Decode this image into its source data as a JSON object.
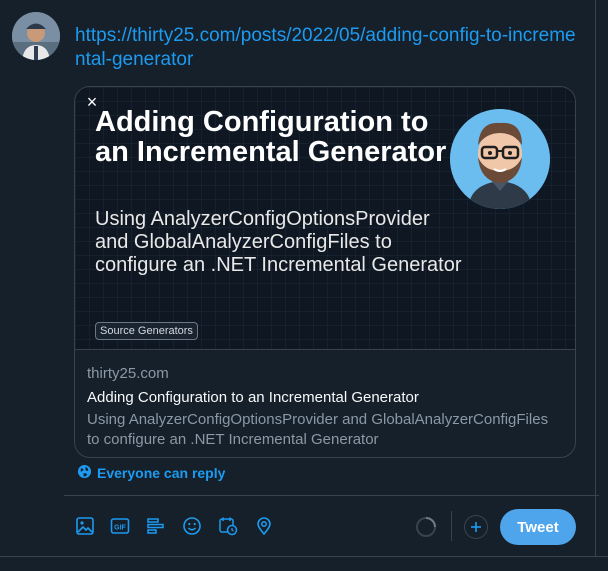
{
  "tweet": {
    "link_text": "https://thirty25.com/posts/2022/05/adding-config-to-incremental-generator"
  },
  "card": {
    "image": {
      "title": "Adding Configuration to an Incremental Generator",
      "subtitle": "Using AnalyzerConfigOptionsProvider and GlobalAnalyzerConfigFiles to configure an .NET Incremental Generator",
      "tag": "Source Generators",
      "close_symbol": "×"
    },
    "domain": "thirty25.com",
    "title": "Adding Configuration to an Incremental Generator",
    "description": "Using AnalyzerConfigOptionsProvider and GlobalAnalyzerConfigFiles to configure an .NET Incremental Generator"
  },
  "reply_setting": {
    "label": "Everyone can reply",
    "icon": "globe-icon"
  },
  "toolbar": {
    "icons": [
      "media-icon",
      "gif-icon",
      "poll-icon",
      "emoji-icon",
      "schedule-icon",
      "location-icon"
    ],
    "tweet_label": "Tweet"
  },
  "colors": {
    "accent": "#1d9bf0",
    "background": "#15202b",
    "tweet_button": "#4ea5ec",
    "border": "#38444d"
  }
}
